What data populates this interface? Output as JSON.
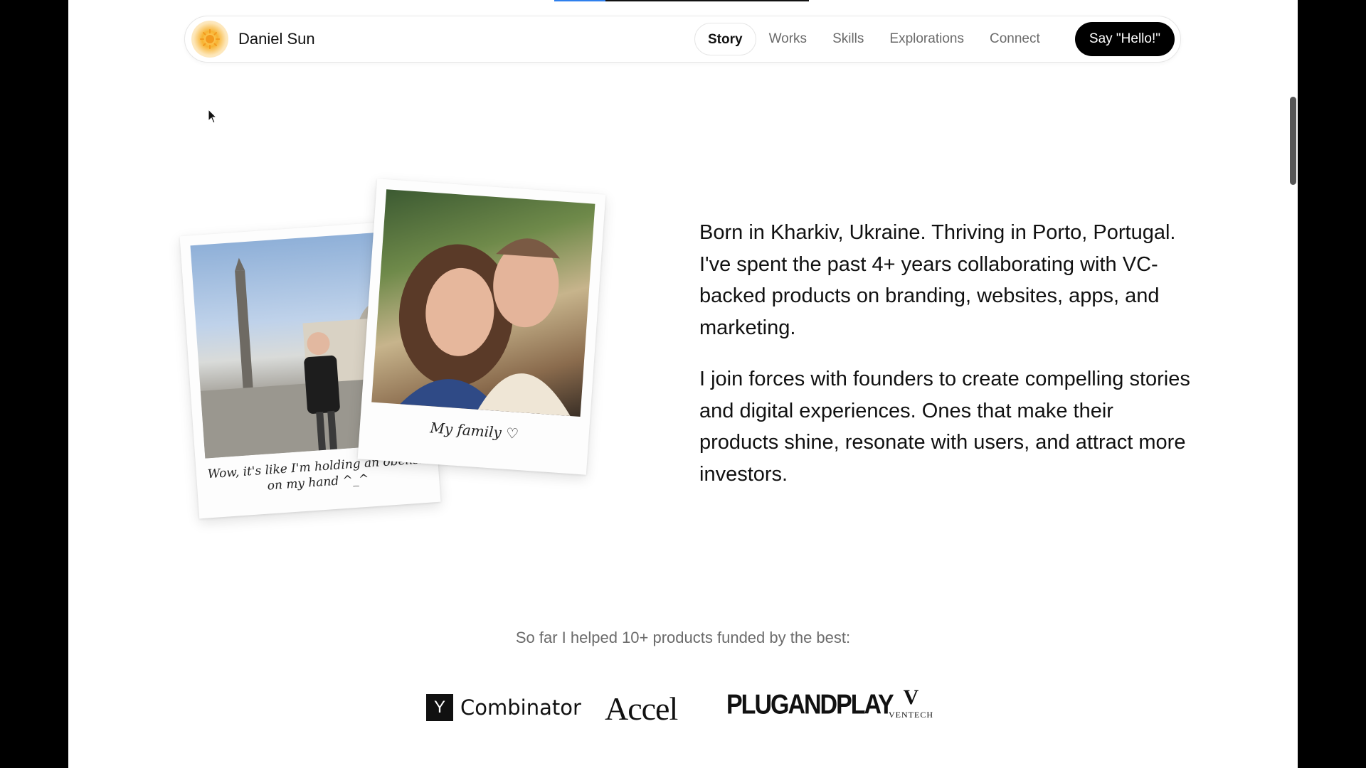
{
  "header": {
    "brand_name": "Daniel Sun",
    "nav": [
      {
        "label": "Story",
        "active": true
      },
      {
        "label": "Works",
        "active": false
      },
      {
        "label": "Skills",
        "active": false
      },
      {
        "label": "Explorations",
        "active": false
      },
      {
        "label": "Connect",
        "active": false
      }
    ],
    "cta_label": "Say \"Hello!\""
  },
  "scroll_progress": 0.2,
  "photos": {
    "left_caption": "Wow, it's like I'm holding an obelisk on my hand ^_^",
    "right_caption": "My family ♡"
  },
  "story": {
    "paragraph_1": "Born in Kharkiv, Ukraine. Thriving in Porto, Portugal. I've spent the past 4+ years collaborating with VC-backed products on branding, websites, apps, and marketing.",
    "paragraph_2": "I join forces with founders to create compelling stories and digital experiences. Ones that make their products shine, resonate with users, and attract more investors."
  },
  "funded": {
    "heading": "So far I helped 10+ products funded by the best:",
    "logos": {
      "yc_mark": "Y",
      "yc_text": "Combinator",
      "accel": "Accel",
      "plug_and_play": "PLUGANDPLAY",
      "ventech_mark": "V",
      "ventech_text": "VENTECH"
    }
  },
  "colors": {
    "accent": "#2f80ed",
    "cta_background": "#000000",
    "sun": "#f7b332"
  }
}
